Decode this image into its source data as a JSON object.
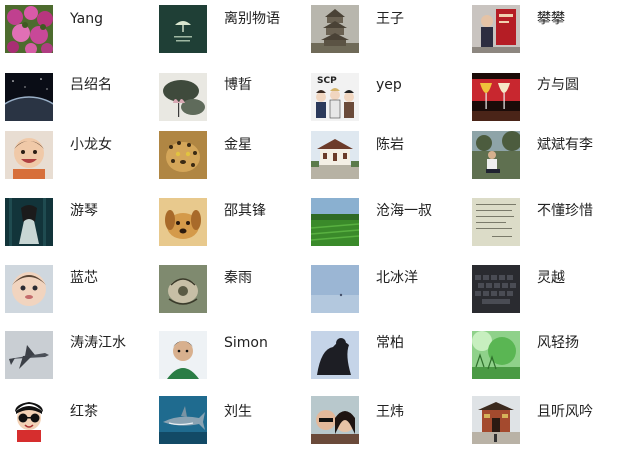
{
  "contacts": [
    {
      "name": "Yang",
      "avatar": "pink-flowers-photo"
    },
    {
      "name": "离别物语",
      "avatar": "dark-green-book-cover"
    },
    {
      "name": "王子",
      "avatar": "pagoda-tower-photo"
    },
    {
      "name": "攀攀",
      "avatar": "person-with-red-poster"
    },
    {
      "name": "吕绍名",
      "avatar": "planet-horizon-space"
    },
    {
      "name": "博晢",
      "avatar": "lotus-ink-painting"
    },
    {
      "name": "yep",
      "avatar": "scp-anime-group"
    },
    {
      "name": "方与圆",
      "avatar": "wine-glasses-art"
    },
    {
      "name": "小龙女",
      "avatar": "smiling-baby-photo"
    },
    {
      "name": "金星",
      "avatar": "leopard-photo"
    },
    {
      "name": "陈岩",
      "avatar": "temple-building-photo"
    },
    {
      "name": "斌斌有李",
      "avatar": "person-sitting-outdoors"
    },
    {
      "name": "游琴",
      "avatar": "woman-in-forest-art"
    },
    {
      "name": "邵其锋",
      "avatar": "puppy-photo"
    },
    {
      "name": "沧海一叔",
      "avatar": "green-field-photo"
    },
    {
      "name": "不懂珍惜",
      "avatar": "handwritten-note-photo"
    },
    {
      "name": "蓝芯",
      "avatar": "baby-face-photo"
    },
    {
      "name": "秦雨",
      "avatar": "sketch-art-photo"
    },
    {
      "name": "北冰洋",
      "avatar": "blue-sky-photo"
    },
    {
      "name": "灵越",
      "avatar": "keyboard-photo"
    },
    {
      "name": "涛涛江水",
      "avatar": "fighter-jet-photo"
    },
    {
      "name": "Simon",
      "avatar": "man-portrait-photo"
    },
    {
      "name": "常柏",
      "avatar": "dark-figure-sky-photo"
    },
    {
      "name": "风轻扬",
      "avatar": "green-nature-photo"
    },
    {
      "name": "红茶",
      "avatar": "cartoon-boy-with-glasses"
    },
    {
      "name": "刘生",
      "avatar": "shark-underwater-photo"
    },
    {
      "name": "王炜",
      "avatar": "couple-selfie-photo"
    },
    {
      "name": "且听风吟",
      "avatar": "traditional-gate-photo"
    }
  ]
}
